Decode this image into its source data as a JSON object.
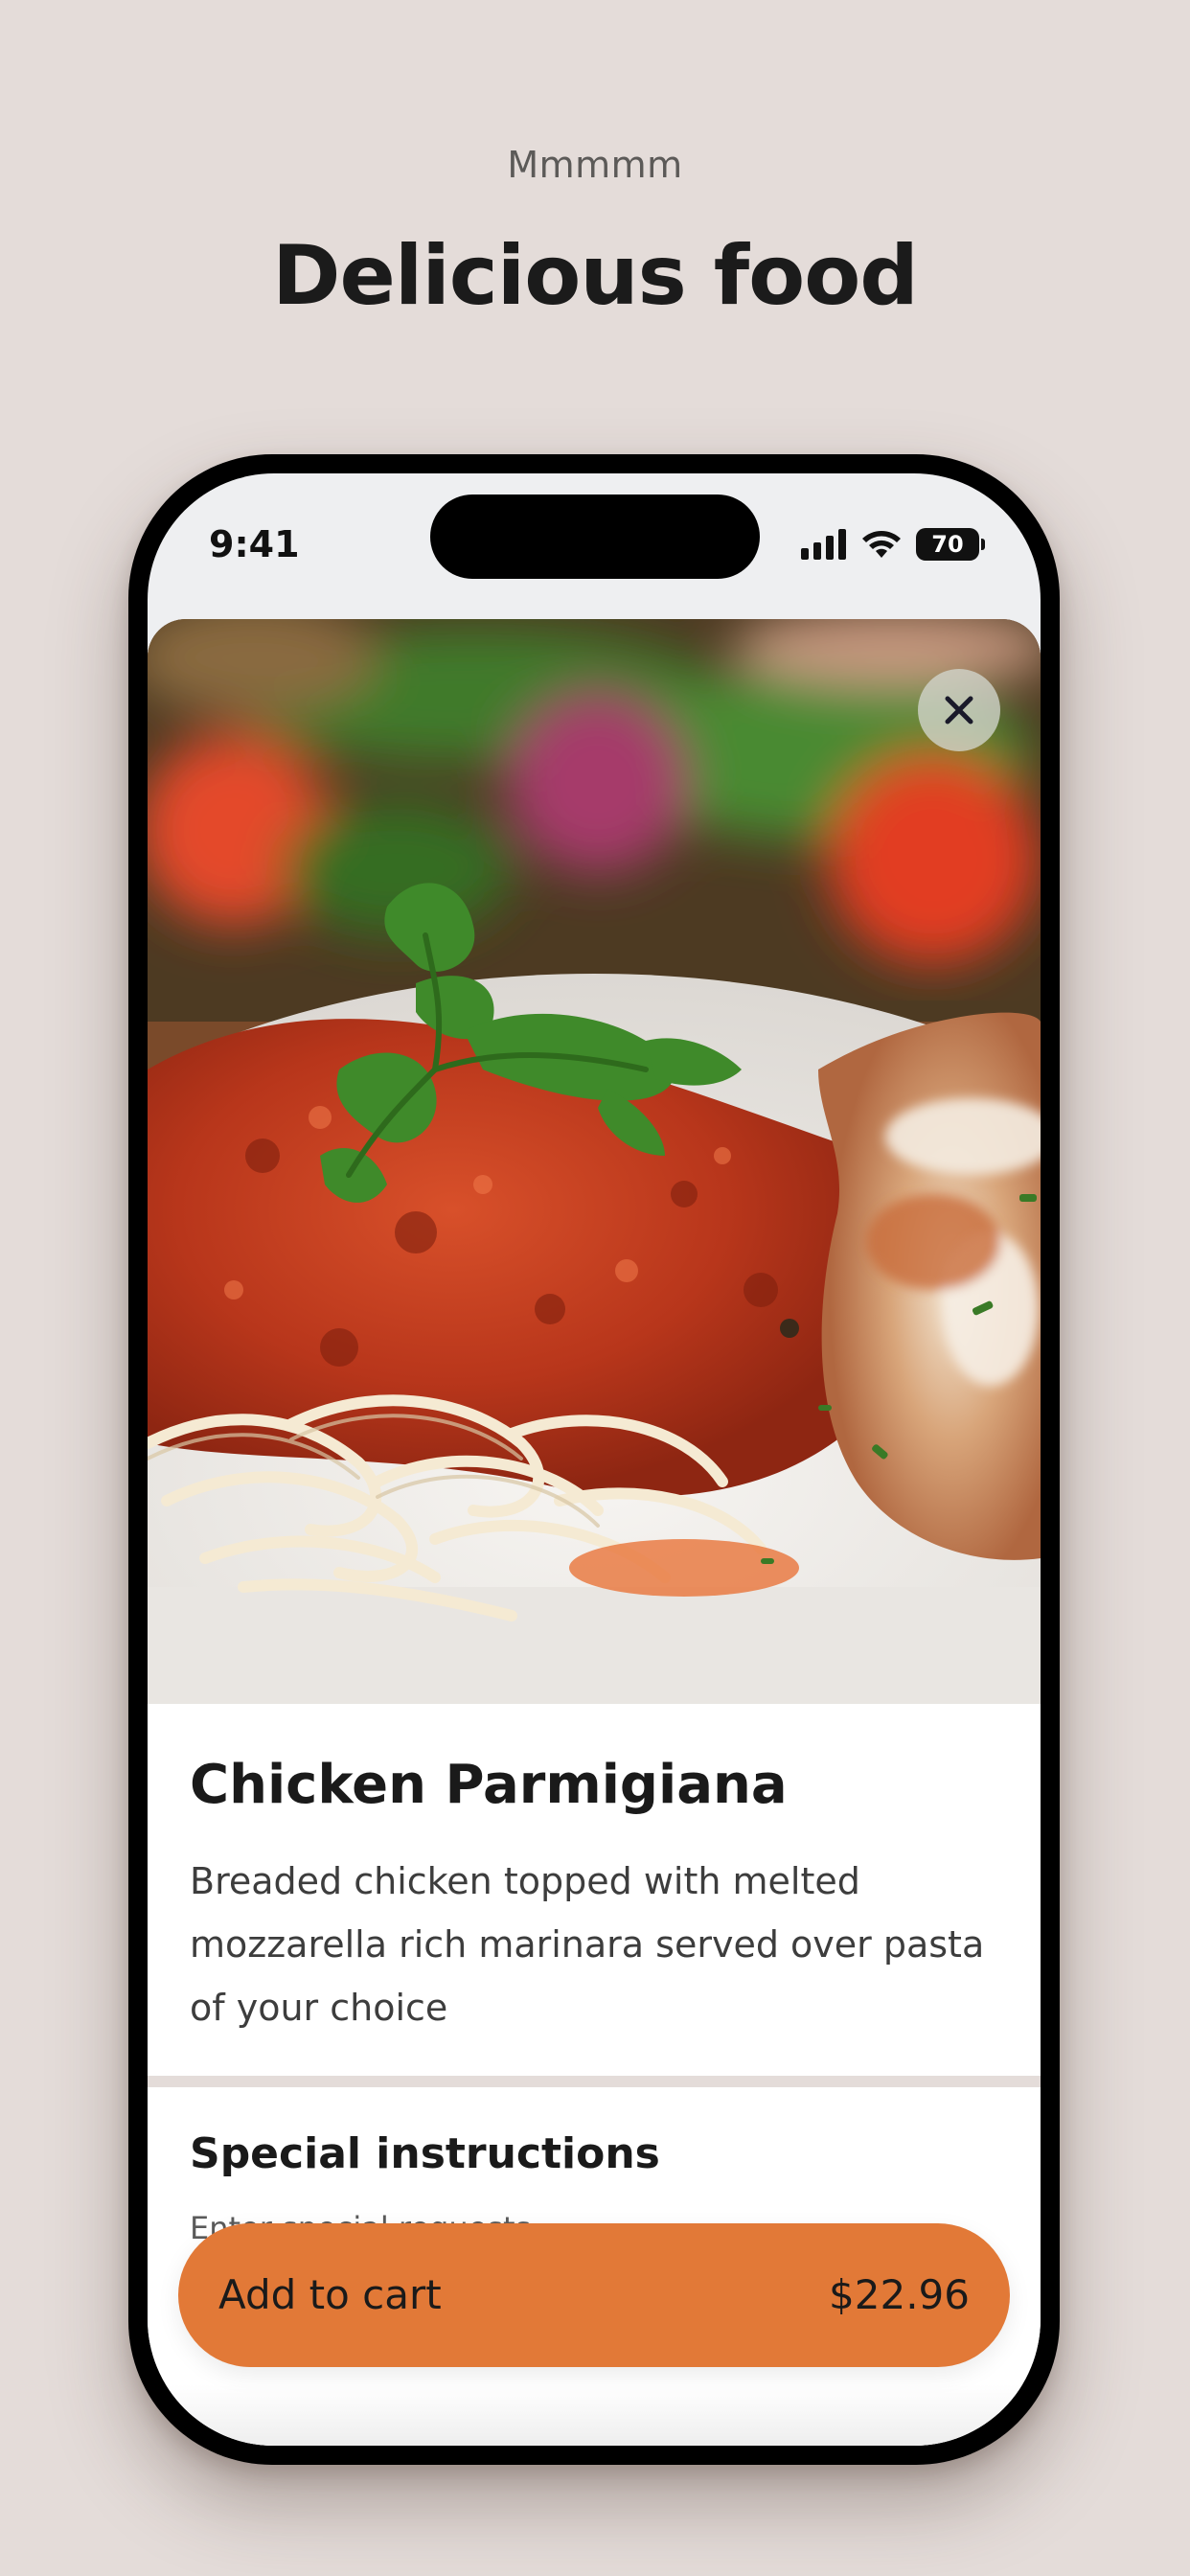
{
  "header": {
    "eyebrow": "Mmmmm",
    "title": "Delicious food"
  },
  "status_bar": {
    "time": "9:41",
    "battery": "70",
    "icons": [
      "signal-icon",
      "wifi-icon",
      "battery-icon"
    ]
  },
  "dish": {
    "image": "chicken-parmigiana-photo",
    "close_icon": "close-icon",
    "name": "Chicken Parmigiana",
    "description": "Breaded chicken topped with melted mozzarella rich marinara served over pasta of your choice"
  },
  "instructions": {
    "title": "Special instructions",
    "placeholder": "Enter special requests"
  },
  "cart": {
    "label": "Add to cart",
    "price": "$22.96"
  },
  "colors": {
    "background": "#e4dcd9",
    "accent": "#e27937",
    "text": "#1a1a1a"
  }
}
